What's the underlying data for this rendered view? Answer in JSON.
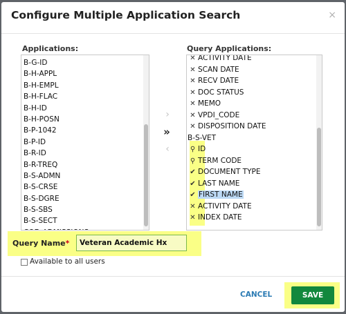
{
  "dialog": {
    "title": "Configure Multiple Application Search",
    "close_symbol": "×"
  },
  "applications": {
    "label": "Applications:",
    "items": [
      "B-G-ID",
      "B-H-APPL",
      "B-H-EMPL",
      "B-H-FLAC",
      "B-H-ID",
      "B-H-POSN",
      "B-P-1042",
      "B-P-ID",
      "B-R-ID",
      "B-R-TREQ",
      "B-S-ADMN",
      "B-S-CRSE",
      "B-S-DGRE",
      "B-S-SBS",
      "B-S-SECT",
      "COE_ADMISSIONS"
    ]
  },
  "transfer": {
    "add_symbol": "›",
    "add_all_symbol": "»",
    "remove_symbol": "‹"
  },
  "query_applications": {
    "label": "Query Applications:",
    "pre_items": [
      {
        "icon": "close-icon",
        "glyph": "✕",
        "label": "ACTIVITY DATE"
      },
      {
        "icon": "close-icon",
        "glyph": "✕",
        "label": "SCAN DATE"
      },
      {
        "icon": "close-icon",
        "glyph": "✕",
        "label": "RECV DATE"
      },
      {
        "icon": "close-icon",
        "glyph": "✕",
        "label": "DOC STATUS"
      },
      {
        "icon": "close-icon",
        "glyph": "✕",
        "label": "MEMO"
      },
      {
        "icon": "close-icon",
        "glyph": "✕",
        "label": "VPDI_CODE"
      },
      {
        "icon": "close-icon",
        "glyph": "✕",
        "label": "DISPOSITION DATE"
      }
    ],
    "group_label": "B-S-VET",
    "group_items": [
      {
        "icon": "search-icon",
        "glyph": "⚲",
        "label": "ID"
      },
      {
        "icon": "search-icon",
        "glyph": "⚲",
        "label": "TERM CODE"
      },
      {
        "icon": "check-icon",
        "glyph": "✔",
        "label": "DOCUMENT TYPE"
      },
      {
        "icon": "check-icon",
        "glyph": "✔",
        "label": "LAST NAME"
      },
      {
        "icon": "check-icon",
        "glyph": "✔",
        "label": "FIRST NAME"
      },
      {
        "icon": "close-icon",
        "glyph": "✕",
        "label": "ACTIVITY DATE"
      },
      {
        "icon": "close-icon",
        "glyph": "✕",
        "label": "INDEX DATE"
      }
    ]
  },
  "query_name": {
    "label": "Query Name",
    "required_marker": "*",
    "value": "Veteran Academic Hx"
  },
  "available_to_all": {
    "label": "Available to all users",
    "checked": false
  },
  "footer": {
    "cancel_label": "CANCEL",
    "save_label": "SAVE"
  },
  "colors": {
    "highlight": "#faff86",
    "save_button": "#12883d",
    "cancel_text": "#2a7ab3",
    "selection": "#bcd9f5"
  }
}
